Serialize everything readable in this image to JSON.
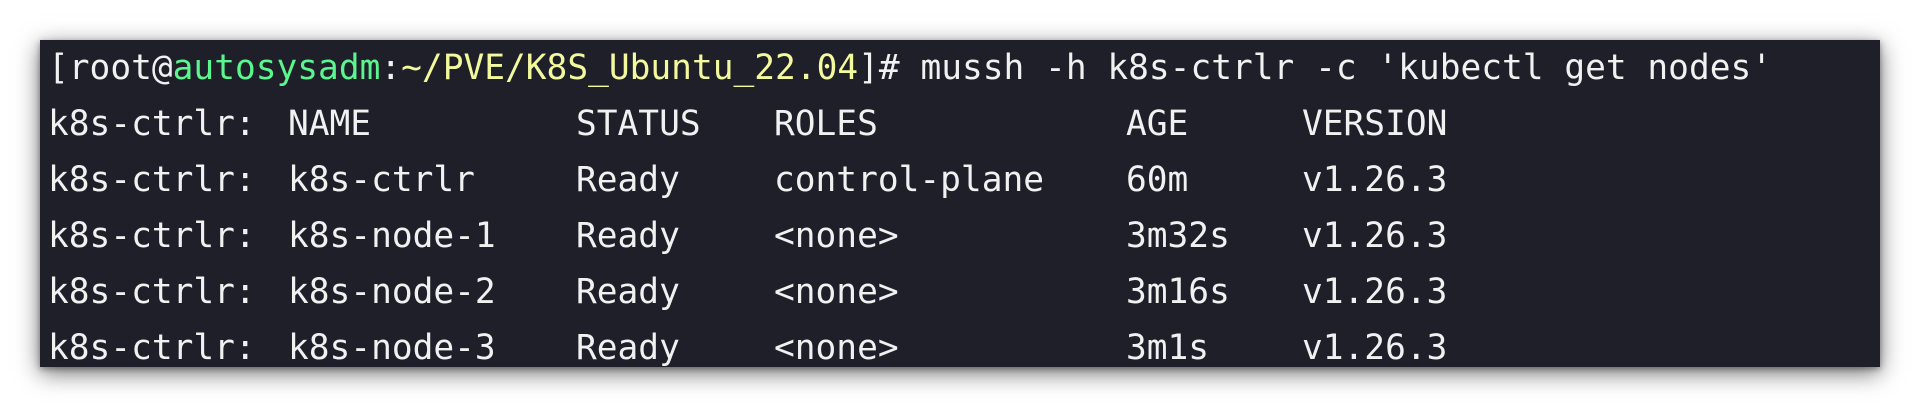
{
  "prompt": {
    "open_bracket": "[",
    "user": "root",
    "at": "@",
    "host": "autosysadm",
    "colon": ":",
    "path": "~/PVE/K8S_Ubuntu_22.04",
    "close": "]# ",
    "command": "mussh -h k8s-ctrlr -c 'kubectl get nodes'"
  },
  "colors": {
    "background": "#1e1f29",
    "text": "#f1f1f1",
    "host": "#5af78e",
    "path": "#f3f99d"
  },
  "output": {
    "headers": {
      "prefix": "k8s-ctrlr:",
      "name": "NAME",
      "status": "STATUS",
      "roles": "ROLES",
      "age": "AGE",
      "version": "VERSION"
    },
    "rows": [
      {
        "prefix": "k8s-ctrlr:",
        "name": "k8s-ctrlr",
        "status": "Ready",
        "roles": "control-plane",
        "age": "60m",
        "version": "v1.26.3"
      },
      {
        "prefix": "k8s-ctrlr:",
        "name": "k8s-node-1",
        "status": "Ready",
        "roles": "<none>",
        "age": "3m32s",
        "version": "v1.26.3"
      },
      {
        "prefix": "k8s-ctrlr:",
        "name": "k8s-node-2",
        "status": "Ready",
        "roles": "<none>",
        "age": "3m16s",
        "version": "v1.26.3"
      },
      {
        "prefix": "k8s-ctrlr:",
        "name": "k8s-node-3",
        "status": "Ready",
        "roles": "<none>",
        "age": "3m1s",
        "version": "v1.26.3"
      }
    ]
  }
}
